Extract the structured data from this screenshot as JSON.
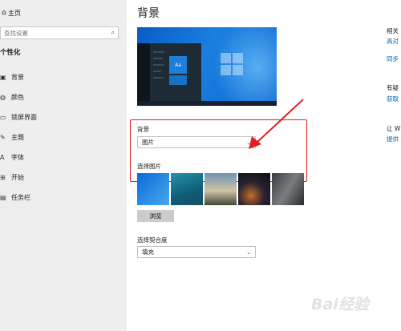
{
  "sidebar": {
    "home": {
      "icon": "home-icon",
      "label": "主页"
    },
    "search": {
      "placeholder": "查找设置",
      "icon": "search-icon"
    },
    "section_title": "个性化",
    "items": [
      {
        "icon": "picture-icon",
        "label": "背景"
      },
      {
        "icon": "palette-icon",
        "label": "颜色"
      },
      {
        "icon": "lock-screen-icon",
        "label": "锁屏界面"
      },
      {
        "icon": "theme-brush-icon",
        "label": "主题"
      },
      {
        "icon": "font-icon",
        "label": "字体"
      },
      {
        "icon": "start-grid-icon",
        "label": "开始"
      },
      {
        "icon": "taskbar-icon",
        "label": "任务栏"
      }
    ]
  },
  "main": {
    "title": "背景",
    "preview": {
      "tile_text": "Aa"
    },
    "background_label": "背景",
    "background_value": "图片",
    "choose_picture_label": "选择图片",
    "browse_label": "浏览",
    "fit_label": "选择契合度",
    "fit_value": "填充"
  },
  "right": {
    "related_prefix": "相关",
    "related_link": "高对",
    "sync_link": "同步",
    "help_prefix": "有疑",
    "help_link": "获取",
    "feedback_prefix": "让 W",
    "feedback_link": "提供"
  },
  "annotation": {
    "color": "#e02020"
  },
  "watermark": "Bai经验"
}
